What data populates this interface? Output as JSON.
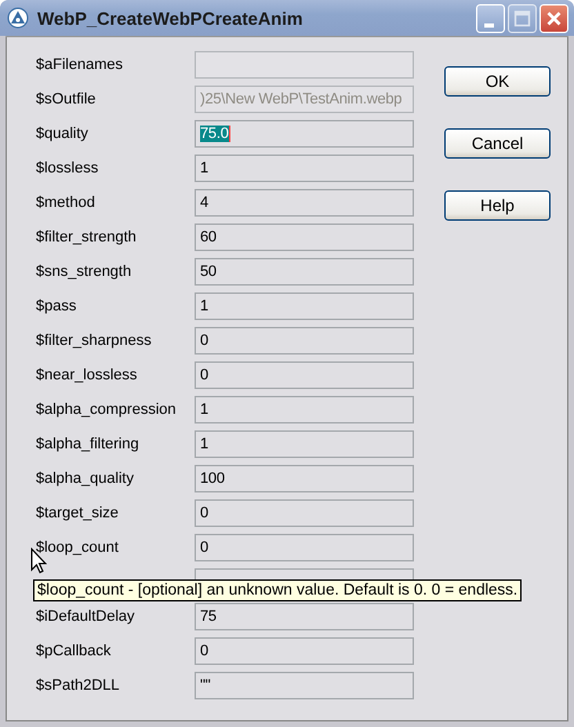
{
  "window": {
    "title": "WebP_CreateWebPCreateAnim"
  },
  "fields": [
    {
      "label": "$aFilenames",
      "disabled": true
    },
    {
      "label": "$sOutfile",
      "value": ")25\\New WebP\\TestAnim.webp",
      "disabled": true
    },
    {
      "label": "$quality",
      "value": "75.0",
      "disabled": false,
      "selected": true
    },
    {
      "label": "$lossless",
      "value": "1",
      "disabled": false,
      "selected": false
    },
    {
      "label": "$method",
      "value": "4",
      "disabled": false,
      "selected": false
    },
    {
      "label": "$filter_strength",
      "value": "60",
      "disabled": false,
      "selected": false
    },
    {
      "label": "$sns_strength",
      "value": "50",
      "disabled": false,
      "selected": false
    },
    {
      "label": "$pass",
      "value": "1",
      "disabled": false,
      "selected": false
    },
    {
      "label": "$filter_sharpness",
      "value": "0",
      "disabled": false,
      "selected": false
    },
    {
      "label": "$near_lossless",
      "value": "0",
      "disabled": false,
      "selected": false
    },
    {
      "label": "$alpha_compression",
      "value": "1",
      "disabled": false,
      "selected": false
    },
    {
      "label": "$alpha_filtering",
      "value": "1",
      "disabled": false,
      "selected": false
    },
    {
      "label": "$alpha_quality",
      "value": "100",
      "disabled": false,
      "selected": false
    },
    {
      "label": "$target_size",
      "value": "0",
      "disabled": false,
      "selected": false
    },
    {
      "label": "$loop_count",
      "value": "0",
      "disabled": false,
      "selected": false
    },
    {
      "disabled": false
    },
    {
      "label": "$iDefaultDelay",
      "value": "75",
      "disabled": false,
      "selected": false
    },
    {
      "label": "$pCallback",
      "value": "0",
      "disabled": false,
      "selected": false
    },
    {
      "label": "$sPath2DLL",
      "value": "\"\"",
      "disabled": false,
      "selected": false
    }
  ],
  "buttons": [
    "OK",
    "Cancel",
    "Help"
  ],
  "tooltip": "$loop_count - [optional] an unknown value. Default is 0. 0 = endless."
}
